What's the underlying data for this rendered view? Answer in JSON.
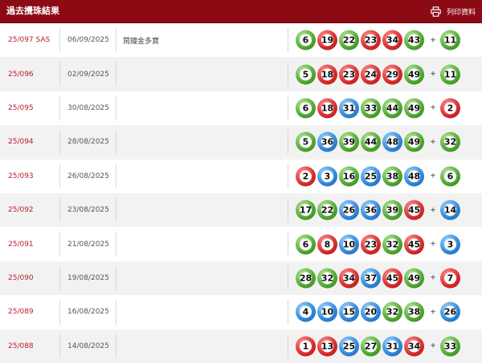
{
  "header": {
    "title": "過去攪珠結果",
    "print_label": "列印資料",
    "background": "#8b0a14"
  },
  "colors": {
    "red": "#d62a2a",
    "blue": "#2e86d8",
    "green": "#4ea72e",
    "draw_text": "#b81e2a"
  },
  "plus_sign": "+",
  "results": [
    {
      "draw": "25/097 SAS",
      "date": "06/09/2025",
      "note": "鬧鐘金多寶",
      "balls": [
        {
          "n": "6",
          "c": "green"
        },
        {
          "n": "19",
          "c": "red"
        },
        {
          "n": "22",
          "c": "green"
        },
        {
          "n": "23",
          "c": "red"
        },
        {
          "n": "34",
          "c": "red"
        },
        {
          "n": "43",
          "c": "green"
        }
      ],
      "extra": {
        "n": "11",
        "c": "green"
      }
    },
    {
      "draw": "25/096",
      "date": "02/09/2025",
      "note": "",
      "balls": [
        {
          "n": "5",
          "c": "green"
        },
        {
          "n": "18",
          "c": "red"
        },
        {
          "n": "23",
          "c": "red"
        },
        {
          "n": "24",
          "c": "red"
        },
        {
          "n": "29",
          "c": "red"
        },
        {
          "n": "49",
          "c": "green"
        }
      ],
      "extra": {
        "n": "11",
        "c": "green"
      }
    },
    {
      "draw": "25/095",
      "date": "30/08/2025",
      "note": "",
      "balls": [
        {
          "n": "6",
          "c": "green"
        },
        {
          "n": "18",
          "c": "red"
        },
        {
          "n": "31",
          "c": "blue"
        },
        {
          "n": "33",
          "c": "green"
        },
        {
          "n": "44",
          "c": "green"
        },
        {
          "n": "49",
          "c": "green"
        }
      ],
      "extra": {
        "n": "2",
        "c": "red"
      }
    },
    {
      "draw": "25/094",
      "date": "28/08/2025",
      "note": "",
      "balls": [
        {
          "n": "5",
          "c": "green"
        },
        {
          "n": "36",
          "c": "blue"
        },
        {
          "n": "39",
          "c": "green"
        },
        {
          "n": "44",
          "c": "green"
        },
        {
          "n": "48",
          "c": "blue"
        },
        {
          "n": "49",
          "c": "green"
        }
      ],
      "extra": {
        "n": "32",
        "c": "green"
      }
    },
    {
      "draw": "25/093",
      "date": "26/08/2025",
      "note": "",
      "balls": [
        {
          "n": "2",
          "c": "red"
        },
        {
          "n": "3",
          "c": "blue"
        },
        {
          "n": "16",
          "c": "green"
        },
        {
          "n": "25",
          "c": "blue"
        },
        {
          "n": "38",
          "c": "green"
        },
        {
          "n": "48",
          "c": "blue"
        }
      ],
      "extra": {
        "n": "6",
        "c": "green"
      }
    },
    {
      "draw": "25/092",
      "date": "23/08/2025",
      "note": "",
      "balls": [
        {
          "n": "17",
          "c": "green"
        },
        {
          "n": "22",
          "c": "green"
        },
        {
          "n": "26",
          "c": "blue"
        },
        {
          "n": "36",
          "c": "blue"
        },
        {
          "n": "39",
          "c": "green"
        },
        {
          "n": "45",
          "c": "red"
        }
      ],
      "extra": {
        "n": "14",
        "c": "blue"
      }
    },
    {
      "draw": "25/091",
      "date": "21/08/2025",
      "note": "",
      "balls": [
        {
          "n": "6",
          "c": "green"
        },
        {
          "n": "8",
          "c": "red"
        },
        {
          "n": "10",
          "c": "blue"
        },
        {
          "n": "23",
          "c": "red"
        },
        {
          "n": "32",
          "c": "green"
        },
        {
          "n": "45",
          "c": "red"
        }
      ],
      "extra": {
        "n": "3",
        "c": "blue"
      }
    },
    {
      "draw": "25/090",
      "date": "19/08/2025",
      "note": "",
      "balls": [
        {
          "n": "28",
          "c": "green"
        },
        {
          "n": "32",
          "c": "green"
        },
        {
          "n": "34",
          "c": "red"
        },
        {
          "n": "37",
          "c": "blue"
        },
        {
          "n": "45",
          "c": "red"
        },
        {
          "n": "49",
          "c": "green"
        }
      ],
      "extra": {
        "n": "7",
        "c": "red"
      }
    },
    {
      "draw": "25/089",
      "date": "16/08/2025",
      "note": "",
      "balls": [
        {
          "n": "4",
          "c": "blue"
        },
        {
          "n": "10",
          "c": "blue"
        },
        {
          "n": "15",
          "c": "blue"
        },
        {
          "n": "20",
          "c": "blue"
        },
        {
          "n": "32",
          "c": "green"
        },
        {
          "n": "38",
          "c": "green"
        }
      ],
      "extra": {
        "n": "26",
        "c": "blue"
      }
    },
    {
      "draw": "25/088",
      "date": "14/08/2025",
      "note": "",
      "balls": [
        {
          "n": "1",
          "c": "red"
        },
        {
          "n": "13",
          "c": "red"
        },
        {
          "n": "25",
          "c": "blue"
        },
        {
          "n": "27",
          "c": "green"
        },
        {
          "n": "31",
          "c": "blue"
        },
        {
          "n": "34",
          "c": "red"
        }
      ],
      "extra": {
        "n": "33",
        "c": "green"
      }
    }
  ]
}
